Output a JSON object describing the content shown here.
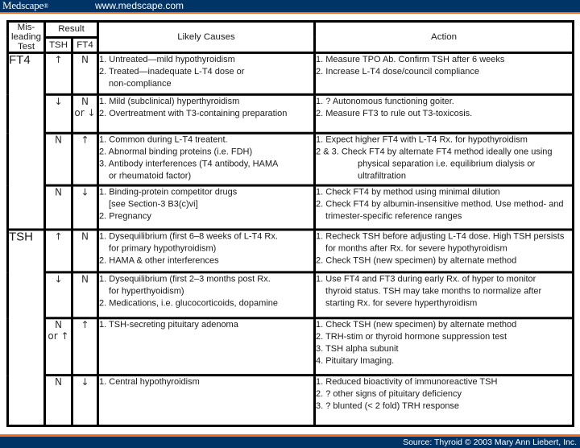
{
  "header_bar": {
    "brand": "Medscape",
    "brand_mark": "®",
    "url": "www.medscape.com"
  },
  "footer_bar": {
    "source": "Source: Thyroid © 2003 Mary Ann Liebert, Inc."
  },
  "table": {
    "headers": {
      "misleading_test": [
        "Mis-",
        "leading",
        "Test"
      ],
      "result": "Result",
      "tsh": "TSH",
      "ft4": "FT4",
      "likely_causes": "Likely Causes",
      "action": "Action"
    },
    "groups": [
      {
        "test": "FT4",
        "rows": [
          {
            "tsh": [
              "↑"
            ],
            "ft4": [
              "N"
            ],
            "causes": [
              {
                "text": "1.  Untreated—mild hypothyroidism"
              },
              {
                "text": "2. Treated—inadequate L-T4 dose or"
              },
              {
                "text": "non-compliance",
                "indent": true
              }
            ],
            "actions": [
              {
                "text": "1.  Measure TPO Ab. Confirm TSH after 6 weeks"
              },
              {
                "text": "2.  Increase L-T4 dose/council compliance"
              }
            ]
          },
          {
            "tsh": [
              "↓"
            ],
            "ft4": [
              "N",
              "or ↓"
            ],
            "causes": [
              {
                "text": "1.  Mild (subclinical) hyperthyroidism"
              },
              {
                "text": "2.  Overtreatment with T3-containing preparation"
              }
            ],
            "actions": [
              {
                "text": "1.  ? Autonomous functioning goiter."
              },
              {
                "text": "2.  Measure FT3 to rule out T3-toxicosis."
              }
            ]
          },
          {
            "tsh": [
              "N"
            ],
            "ft4": [
              "↑"
            ],
            "causes": [
              {
                "text": "1.  Common during L-T4 treatent."
              },
              {
                "text": "2.  Abnormal binding proteins (i.e. FDH)"
              },
              {
                "text": "3.  Antibody interferences (T4 antibody, HAMA"
              },
              {
                "text": "or rheumatoid factor)",
                "indent": true
              }
            ],
            "actions": [
              {
                "text": "1.  Expect higher FT4 with L-T4 Rx. for hypothyroidism"
              },
              {
                "text": "2 & 3.  Check FT4 by alternate FT4 method ideally one using"
              },
              {
                "text": "physical separation i.e. equilibrium dialysis or",
                "indent2": true
              },
              {
                "text": "ultrafiltration",
                "indent2": true
              }
            ]
          },
          {
            "tsh": [
              "N"
            ],
            "ft4": [
              "↓"
            ],
            "causes": [
              {
                "text": "1.  Binding-protein competitor drugs"
              },
              {
                "text": "[see Section-3 B3(c)vi]",
                "indent": true
              },
              {
                "text": "2.  Pregnancy"
              }
            ],
            "actions": [
              {
                "text": "1.  Check FT4 by method using minimal dilution"
              },
              {
                "text": "2.  Check FT4 by albumin-insensitive method. Use method- and"
              },
              {
                "text": "trimester-specific reference ranges",
                "indent": true
              }
            ]
          }
        ]
      },
      {
        "test": "TSH",
        "rows": [
          {
            "tsh": [
              "↑"
            ],
            "ft4": [
              "N"
            ],
            "causes": [
              {
                "text": "1.  Dysequilibrium (first 6–8 weeks of L-T4 Rx."
              },
              {
                "text": "for primary hypothyroidism)",
                "indent": true
              },
              {
                "text": "2.  HAMA & other interferences"
              }
            ],
            "actions": [
              {
                "text": "1.  Recheck TSH before adjusting L-T4 dose. High TSH persists"
              },
              {
                "text": "for months after Rx. for severe hypothyroidism",
                "indent": true
              },
              {
                "text": "2.  Check TSH (new specimen) by alternate method"
              }
            ]
          },
          {
            "tsh": [
              "↓"
            ],
            "ft4": [
              "N"
            ],
            "causes": [
              {
                "text": "1.  Dysequilibrium (first 2–3 months post Rx."
              },
              {
                "text": "for hyperthyoidism)",
                "indent": true
              },
              {
                "text": "2.  Medications, i.e. glucocorticoids, dopamine"
              }
            ],
            "actions": [
              {
                "text": "1.  Use FT4 and FT3 during early Rx. of hyper to monitor"
              },
              {
                "text": "thyroid status. TSH may take months to normalize after",
                "indent": true
              },
              {
                "text": "starting Rx. for severe hyperthyroidism",
                "indent": true
              }
            ]
          },
          {
            "tsh": [
              "N",
              "or ↑"
            ],
            "ft4": [
              "↑"
            ],
            "causes": [
              {
                "text": "1.  TSH-secreting pituitary adenoma"
              }
            ],
            "actions": [
              {
                "text": "1.  Check TSH (new specimen) by alternate method"
              },
              {
                "text": "2.  TRH-stim or thyroid hormone suppression test"
              },
              {
                "text": "3.  TSH alpha subunit"
              },
              {
                "text": "4.  Pituitary Imaging."
              }
            ]
          },
          {
            "tsh": [
              "N"
            ],
            "ft4": [
              "↓"
            ],
            "causes": [
              {
                "text": "1.  Central hypothyroidism"
              }
            ],
            "actions": [
              {
                "text": "1.  Reduced bioactivity of immunoreactive TSH"
              },
              {
                "text": "2.  ? other signs of pituitary deficiency"
              },
              {
                "text": "3.  ? blunted (< 2 fold) TRH response"
              }
            ]
          }
        ]
      }
    ]
  }
}
